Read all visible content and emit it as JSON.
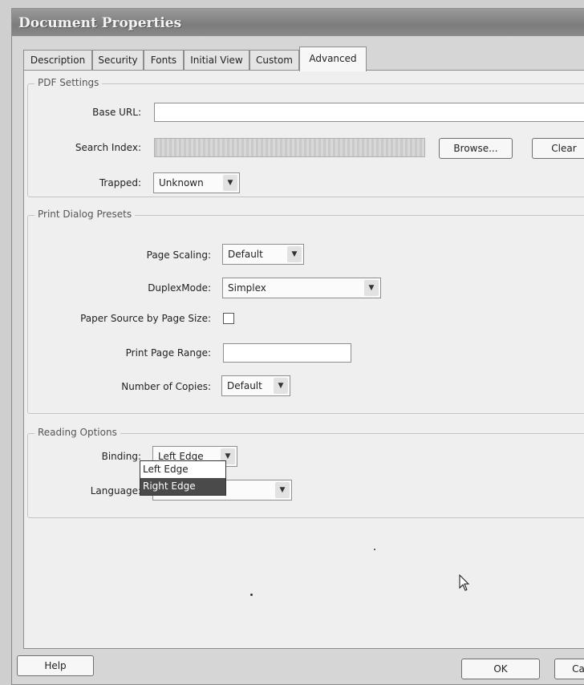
{
  "window": {
    "title": "Document Properties"
  },
  "tabs": [
    {
      "label": "Description"
    },
    {
      "label": "Security"
    },
    {
      "label": "Fonts"
    },
    {
      "label": "Initial View"
    },
    {
      "label": "Custom"
    },
    {
      "label": "Advanced"
    }
  ],
  "pdf_settings": {
    "legend": "PDF Settings",
    "base_url_label": "Base URL:",
    "base_url_value": "",
    "search_index_label": "Search Index:",
    "browse_label": "Browse...",
    "clear_label": "Clear",
    "trapped_label": "Trapped:",
    "trapped_value": "Unknown"
  },
  "print_presets": {
    "legend": "Print Dialog Presets",
    "page_scaling_label": "Page Scaling:",
    "page_scaling_value": "Default",
    "duplex_label": "DuplexMode:",
    "duplex_value": "Simplex",
    "paper_source_label": "Paper Source by Page Size:",
    "paper_source_checked": false,
    "page_range_label": "Print Page Range:",
    "page_range_value": "",
    "copies_label": "Number of Copies:",
    "copies_value": "Default"
  },
  "reading": {
    "legend": "Reading Options",
    "binding_label": "Binding:",
    "binding_value": "Left Edge",
    "binding_options": [
      "Left Edge",
      "Right Edge"
    ],
    "binding_highlighted": "Right Edge",
    "language_label": "Language:",
    "language_value": ""
  },
  "footer": {
    "help_label": "Help",
    "ok_label": "OK",
    "cancel_label": "Ca"
  },
  "icons": {
    "dropdown_arrow": "chevron-down-icon",
    "cursor": "mouse-pointer-icon"
  }
}
